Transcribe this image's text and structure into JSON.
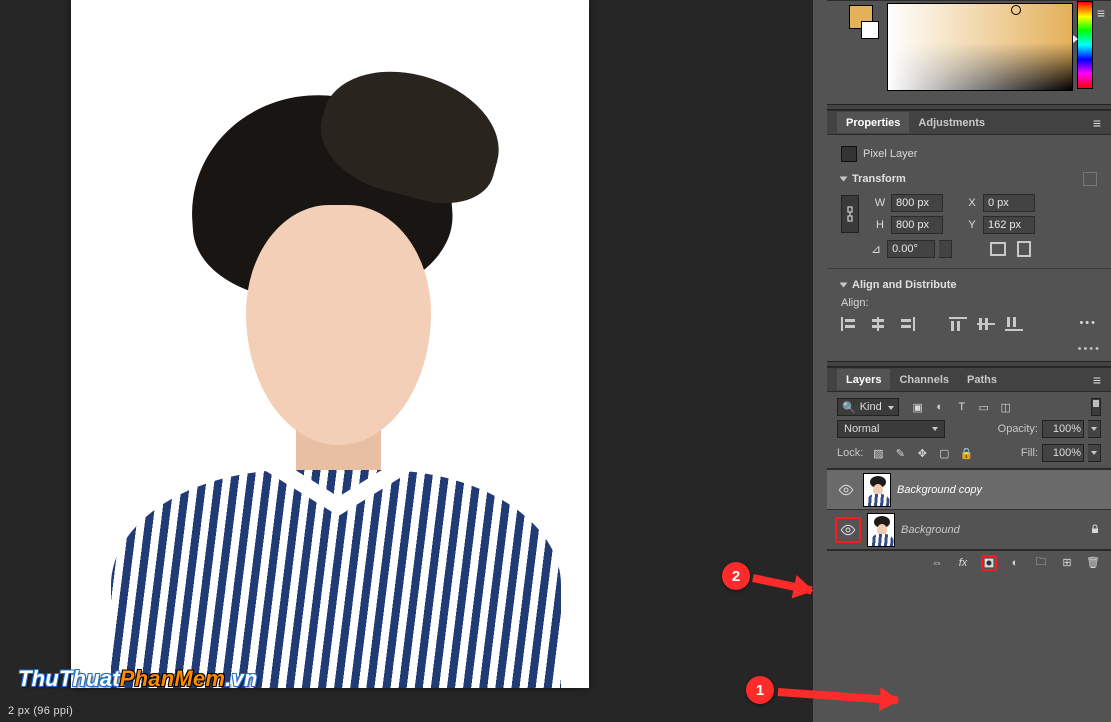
{
  "status_bar": "2 px (96 ppi)",
  "watermark": {
    "part1": "ThuThuat",
    "part2": "PhanMem",
    "part3": ".vn"
  },
  "colors": {
    "foreground_hex": "#e4b05a",
    "background_hex": "#ffffff"
  },
  "properties": {
    "tab_properties": "Properties",
    "tab_adjustments": "Adjustments",
    "type": "Pixel Layer",
    "section_transform": "Transform",
    "w_label": "W",
    "w_value": "800 px",
    "h_label": "H",
    "h_value": "800 px",
    "x_label": "X",
    "x_value": "0 px",
    "y_label": "Y",
    "y_value": "162 px",
    "angle_value": "0.00°",
    "section_align": "Align and Distribute",
    "align_label": "Align:"
  },
  "layers": {
    "tab_layers": "Layers",
    "tab_channels": "Channels",
    "tab_paths": "Paths",
    "kind_label": "Kind",
    "blend_mode": "Normal",
    "opacity_label": "Opacity:",
    "opacity_value": "100%",
    "lock_label": "Lock:",
    "fill_label": "Fill:",
    "fill_value": "100%",
    "items": [
      {
        "name": "Background copy",
        "visible": true,
        "selected": true,
        "locked": false
      },
      {
        "name": "Background",
        "visible": true,
        "selected": false,
        "locked": true
      }
    ]
  },
  "callouts": {
    "step1": "1",
    "step2": "2"
  }
}
